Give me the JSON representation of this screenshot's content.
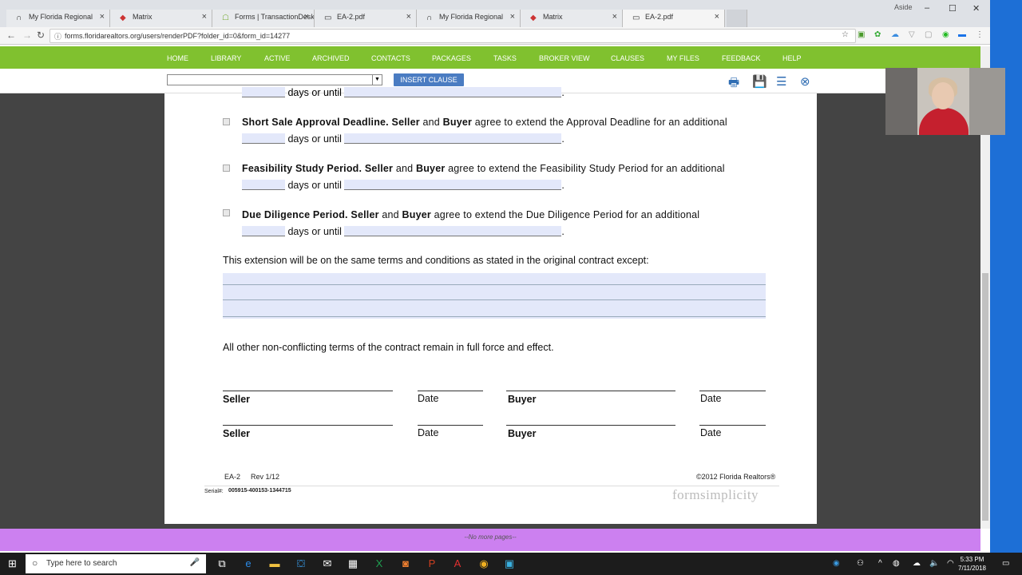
{
  "browser": {
    "tabs": [
      {
        "title": "My Florida Regional",
        "icon": "∩",
        "active": false
      },
      {
        "title": "Matrix",
        "icon": "◆",
        "active": false
      },
      {
        "title": "Forms | TransactionDesk",
        "icon": "☖",
        "active": false
      },
      {
        "title": "EA-2.pdf",
        "icon": "▭",
        "active": false
      },
      {
        "title": "My Florida Regional",
        "icon": "∩",
        "active": false
      },
      {
        "title": "Matrix",
        "icon": "◆",
        "active": false
      },
      {
        "title": "EA-2.pdf",
        "icon": "▭",
        "active": true
      }
    ],
    "user": "Aside",
    "url": "forms.floridarealtors.org/users/renderPDF?folder_id=0&form_id=14277"
  },
  "menu": [
    "HOME",
    "LIBRARY",
    "ACTIVE",
    "ARCHIVED",
    "CONTACTS",
    "PACKAGES",
    "TASKS",
    "BROKER VIEW",
    "CLAUSES",
    "MY FILES",
    "FEEDBACK",
    "HELP"
  ],
  "toolbar": {
    "clause_value": "",
    "insert_label": "INSERT CLAUSE"
  },
  "document": {
    "top_partial": "days or until",
    "clauses": [
      {
        "title": "Short Sale Approval Deadline.",
        "seller": "Seller",
        "and": "and",
        "buyer": "Buyer",
        "rest": "agree to extend the Approval Deadline for an additional",
        "line2": "days or until",
        "period": "."
      },
      {
        "title": "Feasibility Study Period.",
        "seller": "Seller",
        "and": "and",
        "buyer": "Buyer",
        "rest": "agree to extend the Feasibility Study Period for an additional",
        "line2": "days or until",
        "period": "."
      },
      {
        "title": "Due Diligence Period.",
        "seller": "Seller",
        "and": "and",
        "buyer": "Buyer",
        "rest": "agree to extend the Due Diligence Period for an additional",
        "line2": "days or until",
        "period": "."
      }
    ],
    "extension_text": "This extension will be on the same terms and conditions as stated in the original contract except:",
    "other_terms": "All other non-conflicting terms of the contract remain in full force and effect.",
    "signatures": {
      "seller": "Seller",
      "buyer": "Buyer",
      "date": "Date"
    },
    "footer": {
      "form_id": "EA-2",
      "rev": "Rev 1/12",
      "copyright": "©2012 Florida Realtors®",
      "serial_label": "Serial#:",
      "serial": "005915-400153-1344715",
      "logo": "formsimplicity"
    }
  },
  "no_more_pages": "--No more pages--",
  "taskbar": {
    "search_placeholder": "Type here to search",
    "time": "5:33 PM",
    "date": "7/11/2018"
  }
}
